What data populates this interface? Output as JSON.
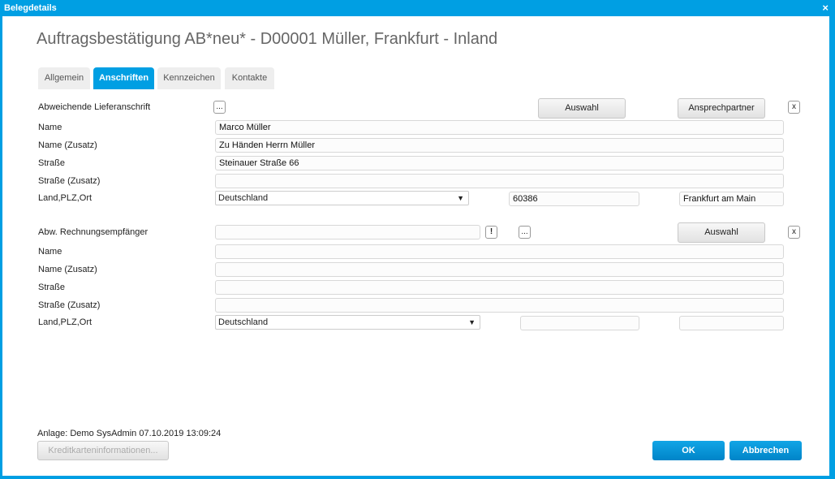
{
  "window": {
    "title": "Belegdetails",
    "close": "×"
  },
  "heading": "Auftragsbestätigung AB*neu* - D00001 Müller, Frankfurt - Inland",
  "tabs": [
    {
      "label": "Allgemein"
    },
    {
      "label": "Anschriften"
    },
    {
      "label": "Kennzeichen"
    },
    {
      "label": "Kontakte"
    }
  ],
  "delivery": {
    "section_label": "Abweichende Lieferanschrift",
    "more": "...",
    "select": "Auswahl",
    "contact": "Ansprechpartner",
    "clear": "x",
    "labels": [
      "Name",
      "Name (Zusatz)",
      "Straße",
      "Straße (Zusatz)",
      "Land,PLZ,Ort"
    ],
    "name": "Marco Müller",
    "name_extra": "Zu Händen Herrn Müller",
    "street": "Steinauer Straße 66",
    "street_extra": "",
    "country": "Deutschland",
    "zip": "60386",
    "city": "Frankfurt am Main"
  },
  "billing": {
    "section_label": "Abw. Rechnungsempfänger",
    "value": "",
    "warn": "!",
    "more": "...",
    "select": "Auswahl",
    "clear": "x",
    "labels": [
      "Name",
      "Name (Zusatz)",
      "Straße",
      "Straße (Zusatz)",
      "Land,PLZ,Ort"
    ],
    "country": "Deutschland",
    "zip": "",
    "city": ""
  },
  "footer": {
    "created": "Anlage: Demo SysAdmin 07.10.2019 13:09:24",
    "credit": "Kreditkarteninformationen...",
    "ok": "OK",
    "cancel": "Abbrechen"
  }
}
